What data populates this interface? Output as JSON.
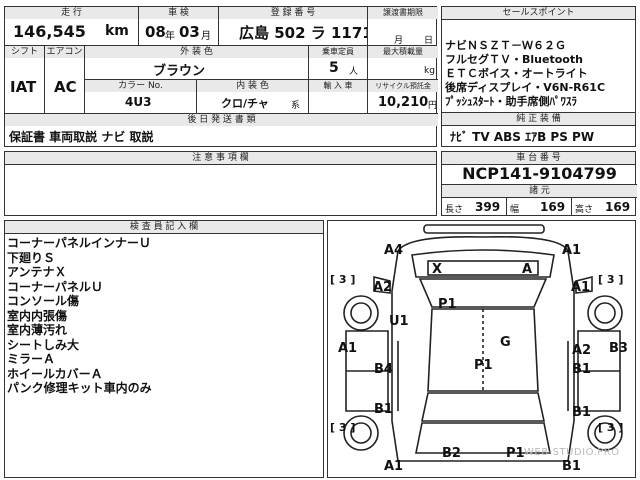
{
  "top": {
    "mileage_label": "走 行",
    "mileage_value": "146,545",
    "mileage_unit": "km",
    "inspection_label": "車 検",
    "inspection_year": "08",
    "inspection_year_unit": "年",
    "inspection_month": "03",
    "inspection_month_unit": "月",
    "reg_label": "登 録 番 号",
    "reg_value": "広島 502 ラ 1171",
    "transfer_label": "譲渡書期限",
    "transfer_month": "月",
    "transfer_day": "日"
  },
  "row2": {
    "shift_label": "シフト",
    "ac_label": "エアコン",
    "shift_value": "IAT",
    "ac_value": "AC",
    "exterior_label": "外 装 色",
    "exterior_value": "ブラウン",
    "capacity_label": "乗車定員",
    "capacity_value": "5",
    "capacity_unit": "人",
    "load_label": "最大積載量",
    "load_unit": "kg",
    "color_no_label": "カラー No.",
    "color_no_value": "4U3",
    "interior_label": "内 装 色",
    "interior_value": "クロ/チャ",
    "interior_unit": "系",
    "import_label": "輸 入 車",
    "recycle_label": "リサイクル預託金",
    "recycle_value": "10,210",
    "recycle_unit": "円",
    "post_label": "後 日 発 送 書 類",
    "post_value": "保証書 車両取説 ナビ 取説"
  },
  "sales": {
    "label": "セールスポイント",
    "lines": [
      "ナビＮＳＺＴ－Ｗ６２Ｇ",
      "フルセグＴＶ・Bluetooth",
      "ＥＴＣボイス・オートライト",
      "後席ディスプレイ・V6N-R61C",
      "ﾌﾟｯｼｭｽﾀｰﾄ・助手席側ﾊﾟﾜｽﾗ"
    ]
  },
  "genuine": {
    "label": "純 正 装 備",
    "value": "ﾅﾋﾞ TV ABS ｴｱB PS PW"
  },
  "notes": {
    "label": "注 意 事 項 欄"
  },
  "vehicle": {
    "chassis_label": "車 台 番 号",
    "chassis_value": "NCP141-9104799",
    "dims_label": "諸 元",
    "length_label": "長さ",
    "length_value": "399",
    "width_label": "幅",
    "width_value": "169",
    "height_label": "高さ",
    "height_value": "169"
  },
  "inspector": {
    "label": "検 査 員 記 入 欄",
    "remarks": [
      "コーナーパネルインナーＵ",
      "下廻りＳ",
      "アンテナＸ",
      "コーナーパネルＵ",
      "コンソール傷",
      "室内内張傷",
      "室内薄汚れ",
      "シートしみ大",
      "ミラーＡ",
      "ホイールカバーＡ",
      "パンク修理キット車内のみ"
    ]
  },
  "diagram": {
    "marks": {
      "a4": "A4",
      "a1_tr": "A1",
      "x": "X",
      "a_roof": "A",
      "b3_l": "[ 3 ]",
      "b3_r": "[ 3 ]",
      "a2_l": "A2",
      "a1_r": "A1",
      "p1_top": "P1",
      "u1": "U1",
      "a1_l": "A1",
      "g": "G",
      "a2_r": "A2",
      "b3_rr": "B3",
      "b4": "B4",
      "p1_mid": "P1",
      "b1_r": "B1",
      "b1_l": "B1",
      "b1_rr": "B1",
      "b3_bl": "[ 3 ]",
      "b3_br": "[ 3 ]",
      "b2": "B2",
      "p1_bot": "P1",
      "a1_bl": "A1",
      "b1_br": "B1"
    },
    "watermark": "WEB-STUDIO.PRO"
  }
}
